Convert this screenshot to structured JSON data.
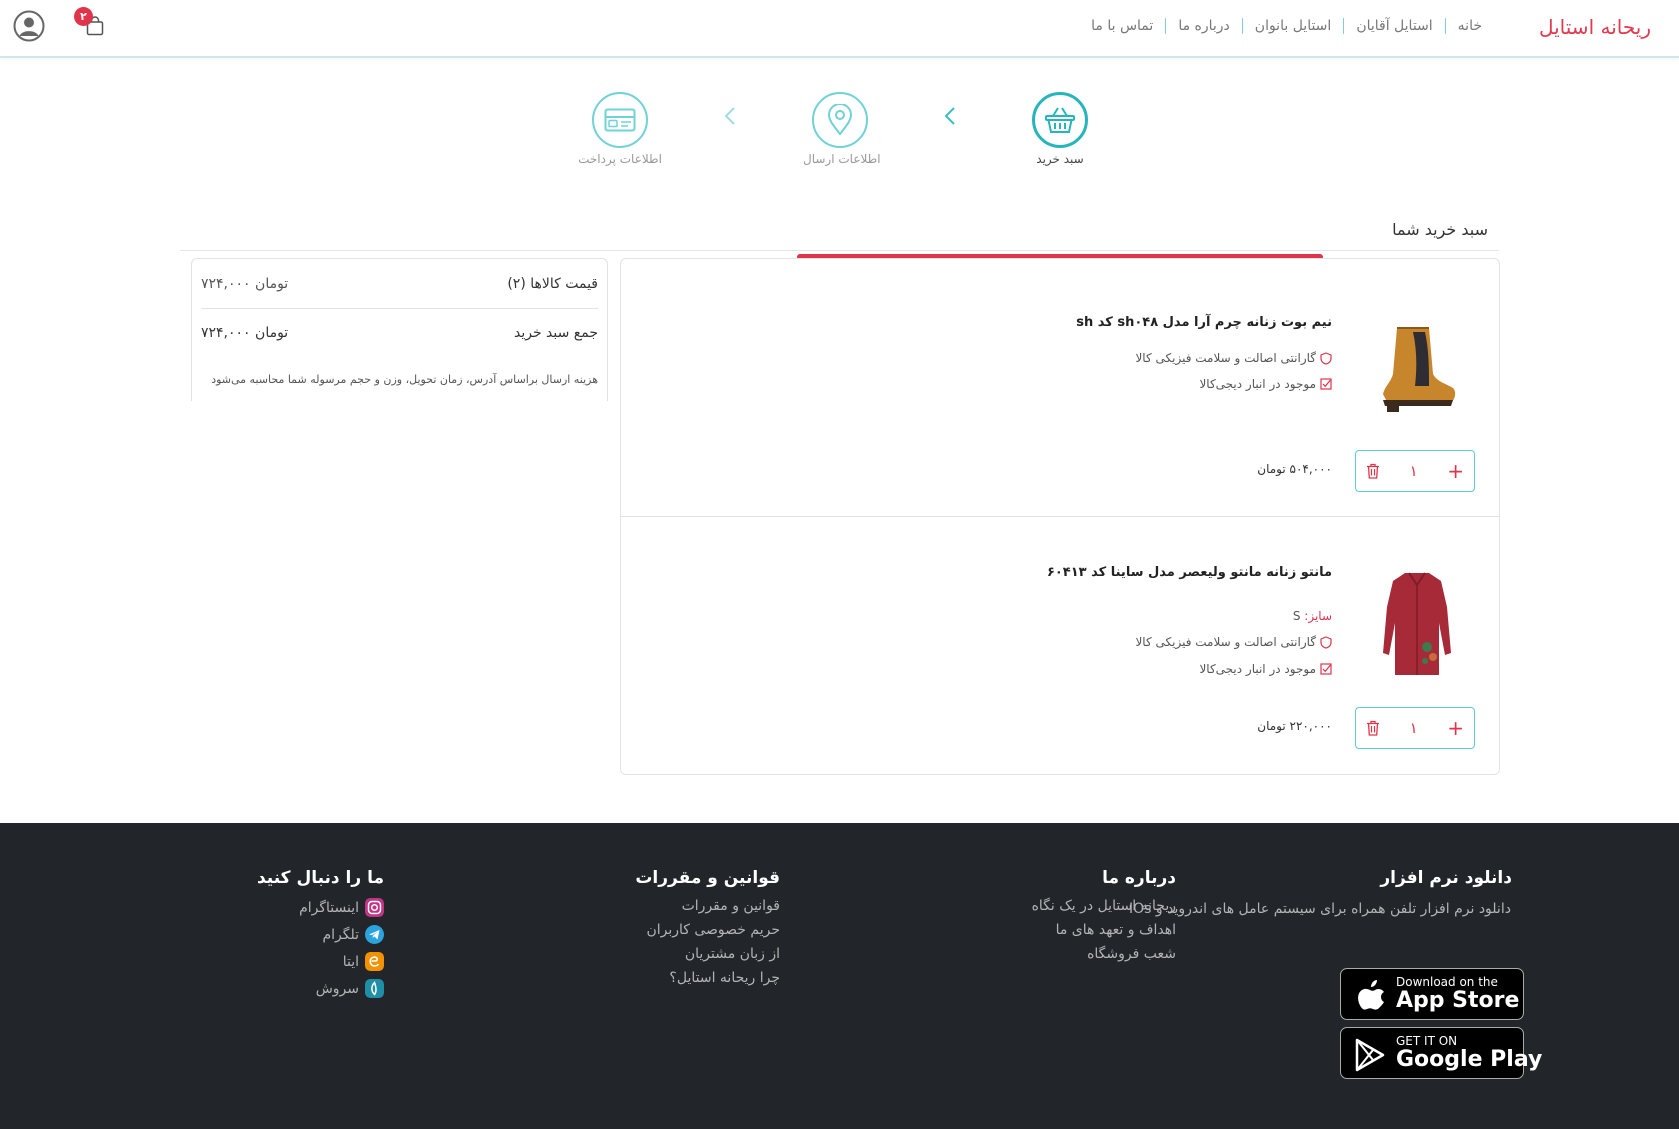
{
  "header": {
    "brand": "ریحانه استایل",
    "nav": [
      "خانه",
      "استایل آقایان",
      "استایل بانوان",
      "درباره ما",
      "تماس با ما"
    ],
    "cart_count": "۲"
  },
  "steps": [
    {
      "label": "سبد خرید",
      "icon": "basket-icon",
      "active": true
    },
    {
      "label": "اطلاعات ارسال",
      "icon": "location-pin-icon",
      "active": false
    },
    {
      "label": "اطلاعات پرداخت",
      "icon": "credit-card-icon",
      "active": false
    }
  ],
  "cart": {
    "title": "سبد خرید شما",
    "items": [
      {
        "title": "نیم بوت زنانه چرم آرا مدل sh۰۴۸ کد sh",
        "guarantee": "گارانتی اصالت و سلامت فیزیکی کالا",
        "stock": "موجود در انبار دیجی‌کالا",
        "price": "۵۰۴,۰۰۰ تومان",
        "qty": "۱"
      },
      {
        "title": "مانتو زنانه مانتو ولیعصر مدل ساینا کد ۶۰۴۱۳",
        "size_label": "سایز:",
        "size_value": "S",
        "guarantee": "گارانتی اصالت و سلامت فیزیکی کالا",
        "stock": "موجود در انبار دیجی‌کالا",
        "price": "۲۲۰,۰۰۰ تومان",
        "qty": "۱"
      }
    ]
  },
  "summary": {
    "items_price_label": "قیمت کالاها (۲)",
    "items_price_value": "۷۲۴,۰۰۰ تومان",
    "total_label": "جمع سبد خرید",
    "total_value": "۷۲۴,۰۰۰ تومان",
    "note": "هزینه ارسال براساس آدرس، زمان تحویل، وزن و حجم مرسوله شما محاسبه می‌شود"
  },
  "footer": {
    "app": {
      "title": "دانلود نرم افزار",
      "desc": "دانلود نرم افزار تلفن همراه برای سیستم عامل های اندروید و IOs",
      "appstore_small": "Download on the",
      "appstore_big": "App Store",
      "googleplay_small": "GET IT ON",
      "googleplay_big": "Google Play"
    },
    "about": {
      "title": "درباره ما",
      "links": [
        "ریحانه استایل در یک نگاه",
        "اهداف و تعهد های ما",
        "شعب فروشگاه"
      ]
    },
    "rules": {
      "title": "قوانین و مقررات",
      "links": [
        "قوانین و مقررات",
        "حریم خصوصی کاربران",
        "از زبان مشتریان",
        "چرا ریحانه استایل؟"
      ]
    },
    "follow": {
      "title": "ما را دنبال کنید",
      "links": [
        "اینستاگرام",
        "تلگرام",
        "ایتا",
        "سروش"
      ]
    }
  },
  "colors": {
    "accent": "#e0344b",
    "teal": "#26b5bd",
    "footer_bg": "#22262b"
  }
}
